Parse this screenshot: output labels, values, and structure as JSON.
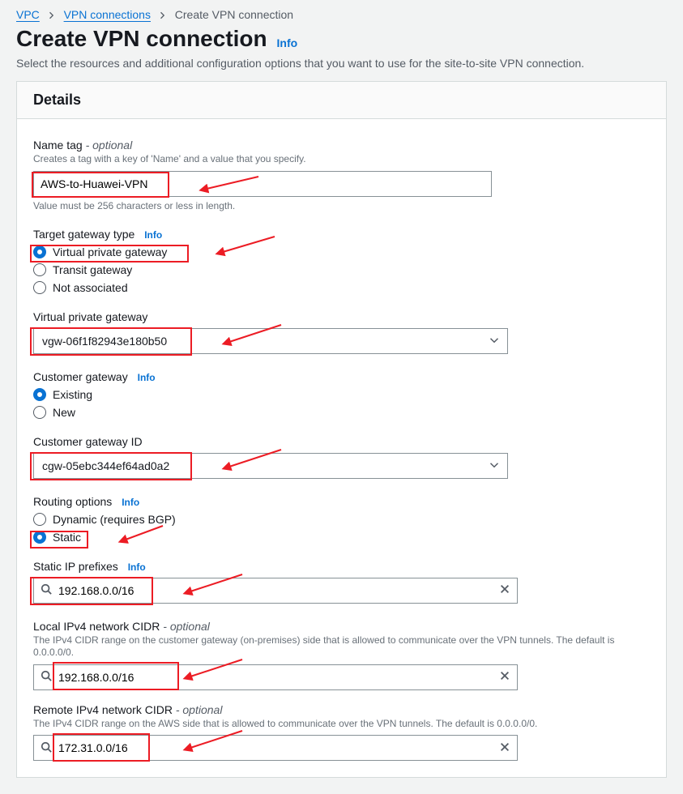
{
  "breadcrumb": {
    "root": "VPC",
    "mid": "VPN connections",
    "current": "Create VPN connection"
  },
  "page": {
    "title": "Create VPN connection",
    "info": "Info",
    "subtitle": "Select the resources and additional configuration options that you want to use for the site-to-site VPN connection."
  },
  "details": {
    "title": "Details",
    "name_tag": {
      "label": "Name tag",
      "optional": " - optional",
      "desc": "Creates a tag with a key of 'Name' and a value that you specify.",
      "value": "AWS-to-Huawei-VPN",
      "constraint": "Value must be 256 characters or less in length."
    },
    "target_type": {
      "label": "Target gateway type",
      "info": "Info",
      "opt_vgw": "Virtual private gateway",
      "opt_tgw": "Transit gateway",
      "opt_na": "Not associated"
    },
    "vgw": {
      "label": "Virtual private gateway",
      "value": "vgw-06f1f82943e180b50"
    },
    "cgw": {
      "label": "Customer gateway",
      "info": "Info",
      "opt_existing": "Existing",
      "opt_new": "New"
    },
    "cgw_id": {
      "label": "Customer gateway ID",
      "value": "cgw-05ebc344ef64ad0a2"
    },
    "routing": {
      "label": "Routing options",
      "info": "Info",
      "opt_dyn": "Dynamic (requires BGP)",
      "opt_static": "Static"
    },
    "static_prefixes": {
      "label": "Static IP prefixes",
      "info": "Info",
      "value": "192.168.0.0/16"
    },
    "local_cidr": {
      "label": "Local IPv4 network CIDR",
      "optional": " - optional",
      "desc": "The IPv4 CIDR range on the customer gateway (on-premises) side that is allowed to communicate over the VPN tunnels. The default is 0.0.0.0/0.",
      "value": "192.168.0.0/16"
    },
    "remote_cidr": {
      "label": "Remote IPv4 network CIDR",
      "optional": " - optional",
      "desc": "The IPv4 CIDR range on the AWS side that is allowed to communicate over the VPN tunnels. The default is 0.0.0.0/0.",
      "value": "172.31.0.0/16"
    }
  },
  "annotations": {
    "highlight_color": "#ec1c24"
  }
}
